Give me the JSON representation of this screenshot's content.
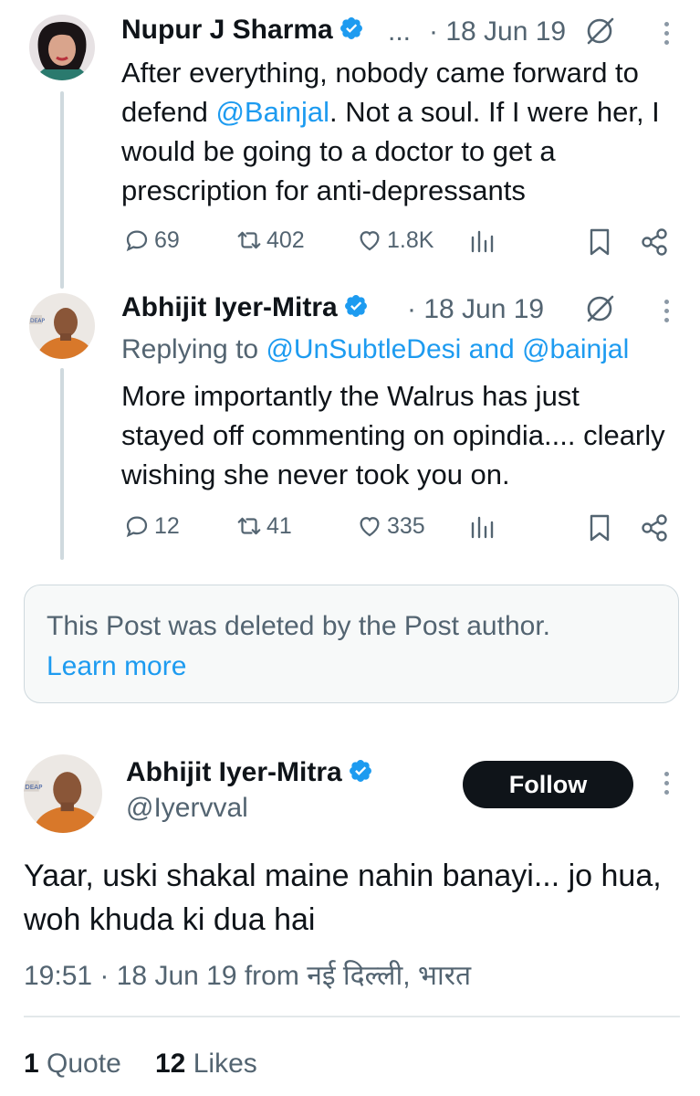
{
  "tweet1": {
    "author_name": "Nupur J Sharma",
    "ellipsis": "...",
    "timestamp": "· 18 Jun 19",
    "text_before": "After everything, nobody came forward to defend ",
    "mention": "@Bainjal",
    "text_after": ". Not a soul. If I were her, I would be going to a doctor to get a prescription for anti-depressants",
    "replies": "69",
    "reposts": "402",
    "likes": "1.8K"
  },
  "tweet2": {
    "author_name": "Abhijit Iyer-Mitra",
    "timestamp": "· 18 Jun 19",
    "replying_prefix": "Replying to ",
    "replying_user1": "@UnSubtleDesi",
    "replying_and": " and ",
    "replying_user2": "@bainjal",
    "text": "More importantly the Walrus has just stayed off commenting on opindia.... clearly wishing she never took you on.",
    "replies": "12",
    "reposts": "41",
    "likes": "335"
  },
  "deleted_post": {
    "message": "This Post was deleted by the Post author.",
    "learn_more": "Learn more"
  },
  "main_tweet": {
    "author_name": "Abhijit Iyer-Mitra",
    "handle": "@Iyervval",
    "follow_label": "Follow",
    "text": "Yaar, uski shakal maine nahin banayi... jo hua, woh khuda ki dua hai",
    "time": "19:51",
    "date": " · 18 Jun 19 from ",
    "location": "नई दिल्ली, भारत",
    "quotes_count": "1",
    "quotes_label": "Quote",
    "likes_count": "12",
    "likes_label": "Likes"
  },
  "colors": {
    "accent": "#1d9bf0",
    "text": "#0f1419",
    "secondary": "#536471"
  }
}
